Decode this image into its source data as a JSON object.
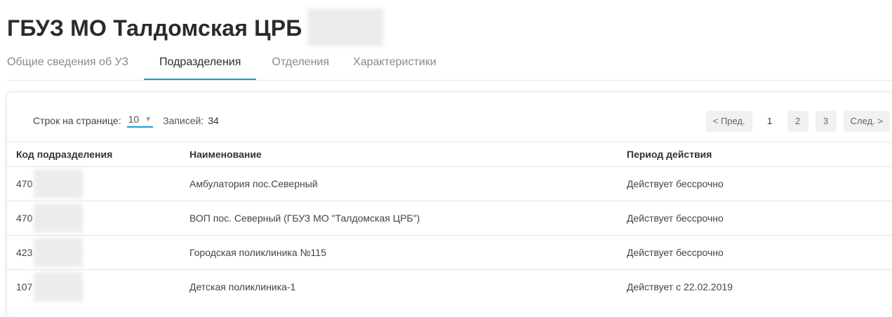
{
  "header": {
    "title": "ГБУЗ МО Талдомская ЦРБ"
  },
  "tabs": [
    {
      "label": "Общие сведения об УЗ",
      "active": false
    },
    {
      "label": "Подразделения",
      "active": true
    },
    {
      "label": "Отделения",
      "active": false
    },
    {
      "label": "Характеристики",
      "active": false
    }
  ],
  "pager": {
    "rows_label": "Строк на странице:",
    "rows_value": "10",
    "records_label": "Записей:",
    "records_count": "34",
    "prev_label": "< Пред.",
    "pages": [
      "1",
      "2",
      "3"
    ],
    "current_page": "1",
    "next_label": "След. >"
  },
  "table": {
    "columns": [
      "Код подразделения",
      "Наименование",
      "Период действия"
    ],
    "rows": [
      {
        "code": "470",
        "name": "Амбулатория пос.Северный",
        "period": "Действует бессрочно"
      },
      {
        "code": "470",
        "name": "ВОП пос. Северный (ГБУЗ МО \"Талдомская ЦРБ\")",
        "period": "Действует бессрочно"
      },
      {
        "code": "423",
        "name": "Городская поликлиника №115",
        "period": "Действует бессрочно"
      },
      {
        "code": "107",
        "name": "Детская поликлиника-1",
        "period": "Действует с 22.02.2019"
      }
    ]
  },
  "colors": {
    "accent": "#1d9bd1"
  }
}
